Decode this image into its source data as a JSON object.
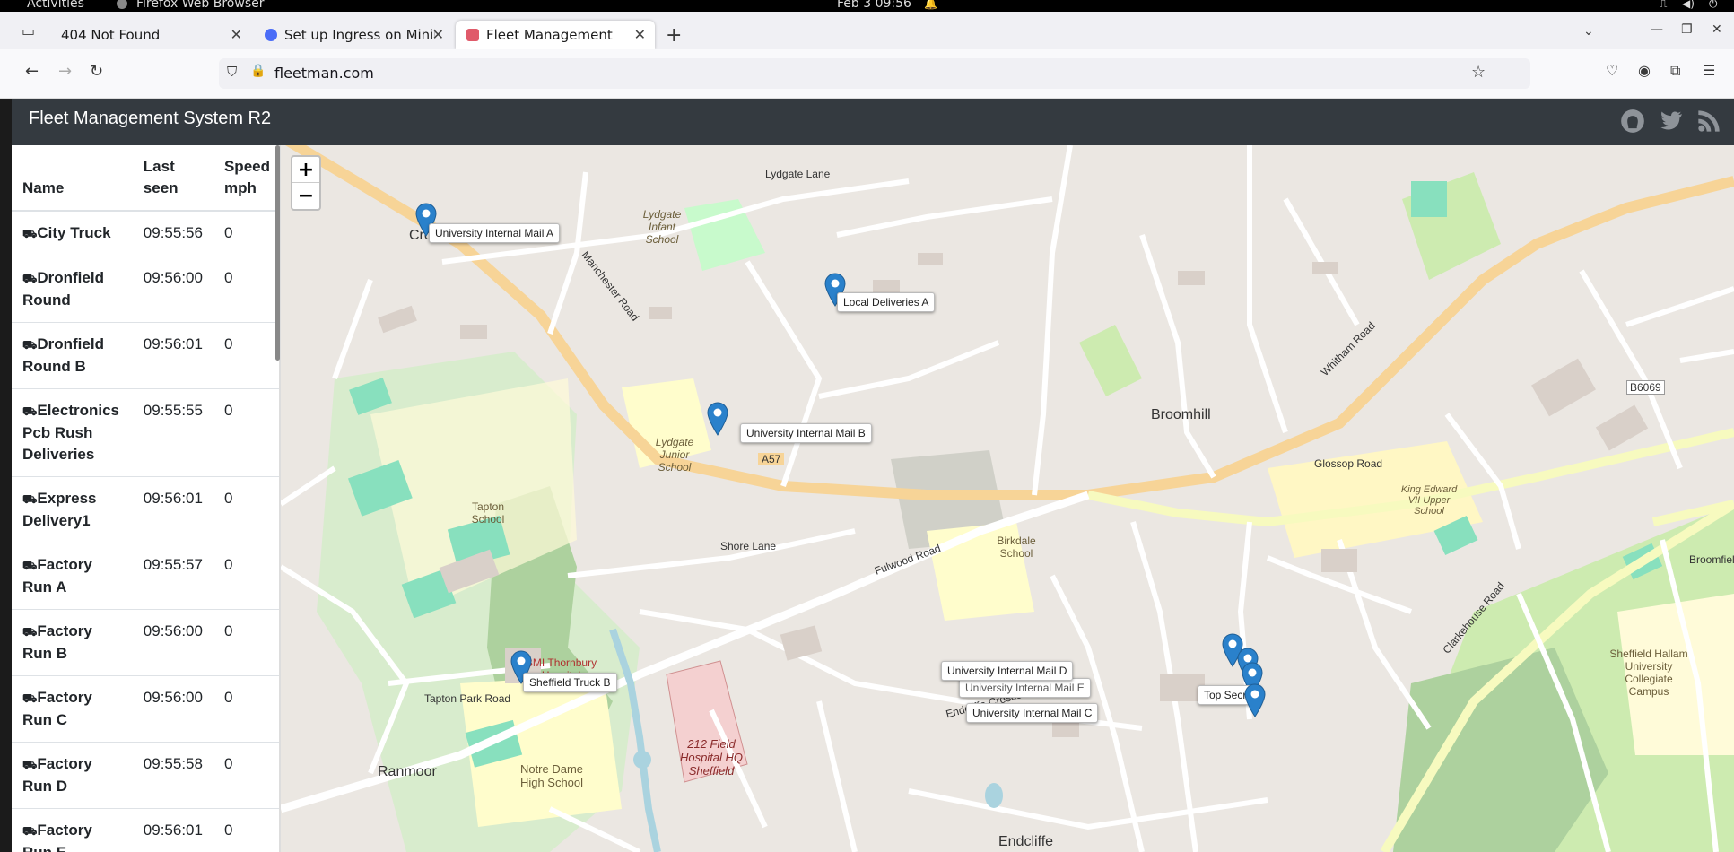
{
  "os": {
    "activities": "Activities",
    "app_name": "Firefox Web Browser",
    "clock": "Feb 3  09:56"
  },
  "browser": {
    "tabs": [
      {
        "title": "404 Not Found"
      },
      {
        "title": "Set up Ingress on Minikul"
      },
      {
        "title": "Fleet Management"
      }
    ],
    "url": "fleetman.com"
  },
  "app": {
    "title": "Fleet Management System R2",
    "icons": [
      "github-icon",
      "twitter-icon",
      "rss-icon"
    ],
    "table": {
      "headers": [
        "Name",
        "Last seen",
        "Speed mph"
      ],
      "rows": [
        {
          "name": "City Truck",
          "last_seen": "09:55:56",
          "speed": "0"
        },
        {
          "name": "Dronfield Round",
          "last_seen": "09:56:00",
          "speed": "0"
        },
        {
          "name": "Dronfield Round B",
          "last_seen": "09:56:01",
          "speed": "0"
        },
        {
          "name": "Electronics Pcb Rush Deliveries",
          "last_seen": "09:55:55",
          "speed": "0"
        },
        {
          "name": "Express Delivery1",
          "last_seen": "09:56:01",
          "speed": "0"
        },
        {
          "name": "Factory Run A",
          "last_seen": "09:55:57",
          "speed": "0"
        },
        {
          "name": "Factory Run B",
          "last_seen": "09:56:00",
          "speed": "0"
        },
        {
          "name": "Factory Run C",
          "last_seen": "09:56:00",
          "speed": "0"
        },
        {
          "name": "Factory Run D",
          "last_seen": "09:55:58",
          "speed": "0"
        },
        {
          "name": "Factory Run E",
          "last_seen": "09:56:01",
          "speed": "0"
        }
      ]
    },
    "map": {
      "zoom_in": "+",
      "zoom_out": "−",
      "vehicle_labels": {
        "a": "University Internal Mail A",
        "local_a": "Local Deliveries A",
        "b": "University Internal Mail B",
        "truck_b": "Sheffield Truck B",
        "d": "University Internal Mail D",
        "e": "University Internal Mail E",
        "top_secret": "Top Secret",
        "c": "University Internal Mail C"
      },
      "place_labels": {
        "crosspool": "Crosspool",
        "broomhill": "Broomhill",
        "ranmoor": "Ranmoor",
        "endcliffe": "Endcliffe",
        "manchester_road": "Manchester Road",
        "a57": "A57",
        "glossop_road": "Glossop Road",
        "whitham_road": "Whitham Road",
        "fulwood_road": "Fulwood Road",
        "clarkehouse_road": "Clarkehouse Road",
        "tapton_school": "Tapton School",
        "lydgate_junior": "Lydgate Junior School",
        "lydgate_infant": "Lydgate Infant School",
        "birkdale_school": "Birkdale School",
        "notre_dame": "Notre Dame High School",
        "field_hospital": "212 Field Hospital HQ Sheffield",
        "bmi": "BMI Thornbury Hospital",
        "king_edward": "King Edward VII Upper School",
        "shu": "Sheffield Hallam University Collegiate Campus",
        "b6069": "B6069",
        "shore_lane": "Shore Lane",
        "tapton_park": "Tapton Park Road",
        "endcliffe_crescent": "Endcliffe Crescent",
        "lydgate_lane": "Lydgate Lane",
        "broomfield": "Broomfield"
      }
    }
  }
}
